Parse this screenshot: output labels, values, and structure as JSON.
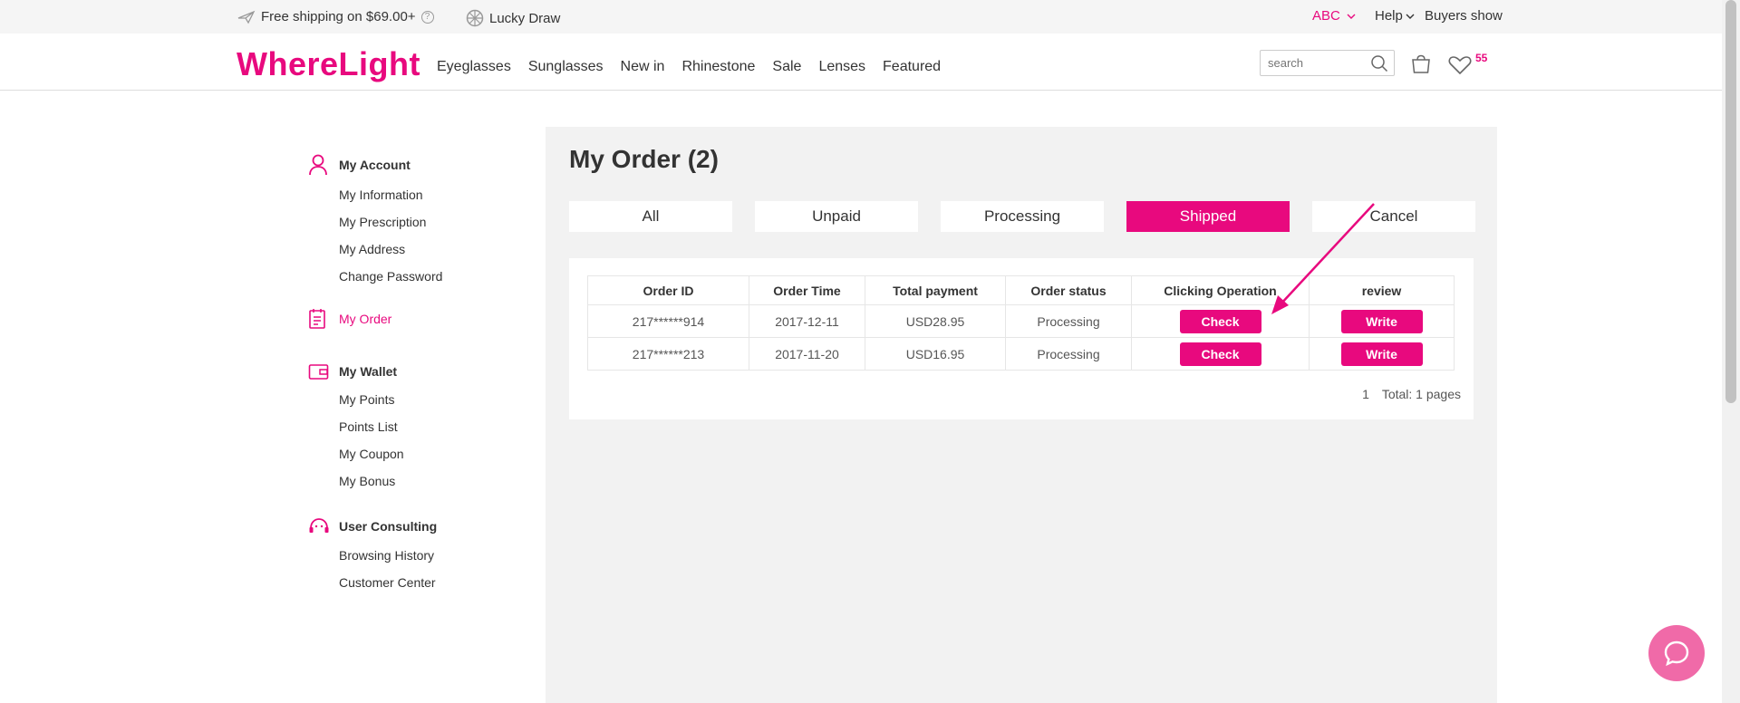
{
  "topbar": {
    "shipping": "Free shipping on $69.00+",
    "help_q": "?",
    "lucky_draw": "Lucky Draw",
    "currency": "ABC",
    "help": "Help",
    "buyers_show": "Buyers show"
  },
  "header": {
    "logo": "WhereLight",
    "nav": [
      "Eyeglasses",
      "Sunglasses",
      "New in",
      "Rhinestone",
      "Sale",
      "Lenses",
      "Featured"
    ],
    "search_placeholder": "search",
    "wishlist_count": "55"
  },
  "sidebar": {
    "account": {
      "title": "My Account",
      "items": [
        "My Information",
        "My Prescription",
        "My Address",
        "Change Password"
      ]
    },
    "order": {
      "title": "My Order"
    },
    "wallet": {
      "title": "My Wallet",
      "items": [
        "My Points",
        "Points List",
        "My Coupon",
        "My Bonus"
      ]
    },
    "consulting": {
      "title": "User Consulting",
      "items": [
        "Browsing History",
        "Customer Center"
      ]
    }
  },
  "main": {
    "title": "My Order (2)",
    "tabs": [
      "All",
      "Unpaid",
      "Processing",
      "Shipped",
      "Cancel"
    ],
    "active_tab": "Shipped",
    "table": {
      "headers": [
        "Order ID",
        "Order Time",
        "Total payment",
        "Order status",
        "Clicking Operation",
        "review"
      ],
      "rows": [
        {
          "id": "217******914",
          "time": "2017-12-11",
          "total": "USD28.95",
          "status": "Processing",
          "op": "Check",
          "review": "Write"
        },
        {
          "id": "217******213",
          "time": "2017-11-20",
          "total": "USD16.95",
          "status": "Processing",
          "op": "Check",
          "review": "Write"
        }
      ]
    },
    "pager": {
      "page": "1",
      "total": "Total: 1 pages"
    }
  },
  "colors": {
    "accent": "#e8097e",
    "panel_bg": "#f2f2f2",
    "chat_bg": "#f06aa8"
  }
}
